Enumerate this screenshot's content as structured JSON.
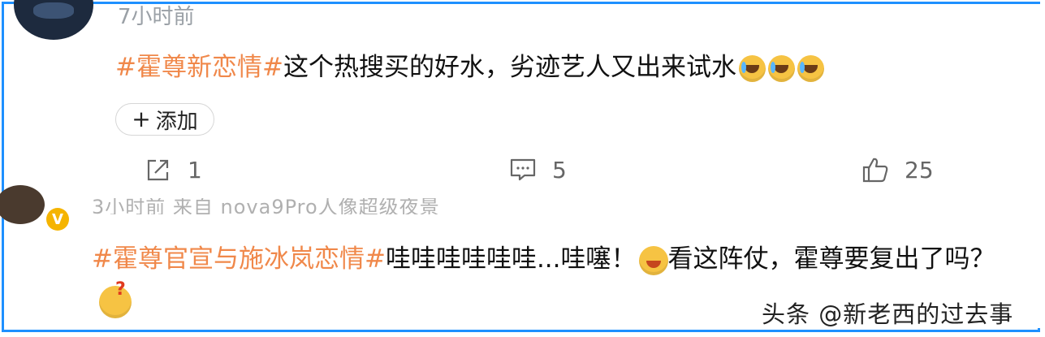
{
  "comment1": {
    "time": "7小时前",
    "hashtag": "#霍尊新恋情#",
    "text": "这个热搜买的好水，劣迹艺人又出来试水",
    "emojis": [
      "laugh-cry-emoji",
      "laugh-cry-emoji",
      "laugh-cry-emoji"
    ],
    "add_button": {
      "icon": "plus-icon",
      "label": "添加"
    },
    "actions": {
      "share": {
        "icon": "share-icon",
        "count": "1"
      },
      "comment": {
        "icon": "comment-icon",
        "count": "5"
      },
      "like": {
        "icon": "thumbs-up-icon",
        "count": "25"
      }
    }
  },
  "comment2": {
    "meta": "3小时前 来自 nova9Pro人像超级夜景",
    "hashtag": "#霍尊官宣与施冰岚恋情#",
    "text": "哇哇哇哇哇哇...哇噻！",
    "text2": "看这阵仗，霍尊要复出了吗？",
    "emojis": [
      "drool-emoji",
      "question-emoji"
    ]
  },
  "watermark": "头条 @新老西的过去事",
  "colors": {
    "hashtag": "#f0884a",
    "frame": "#1e90ff",
    "verified": "#f5b400"
  }
}
